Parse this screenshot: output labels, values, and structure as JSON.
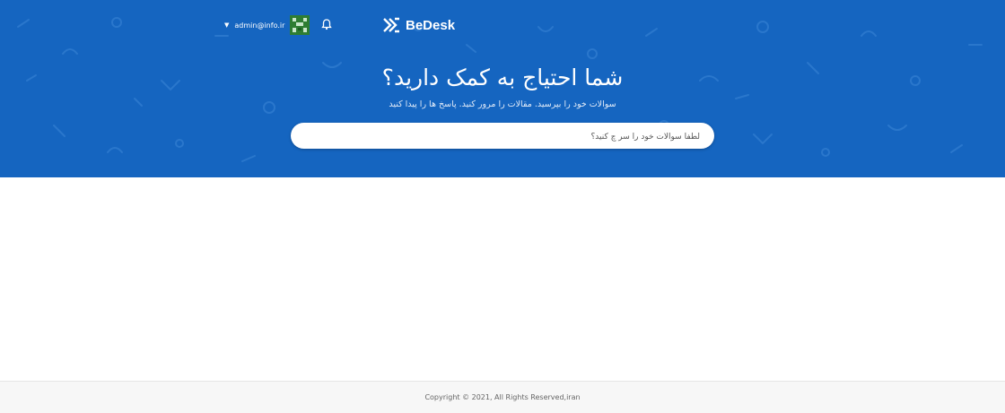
{
  "header": {
    "user_email": "admin@info.ir",
    "logo_text": "BeDesk",
    "icons": [
      "caret-down-icon",
      "avatar",
      "bell-icon",
      "logo-icon"
    ]
  },
  "hero": {
    "title": "شما احتیاج به کمک دارید؟",
    "subtitle": "سوالات خود را بپرسید. مقالات را مرور کنید. پاسخ ها را پیدا کنید",
    "search_placeholder": "لطفا سوالات خود را سر چ کنید؟"
  },
  "footer": {
    "copyright": "Copyright © 2021, All Rights Reserved,iran"
  },
  "colors": {
    "hero_background": "#1565c0",
    "avatar": "#2e7d32"
  }
}
